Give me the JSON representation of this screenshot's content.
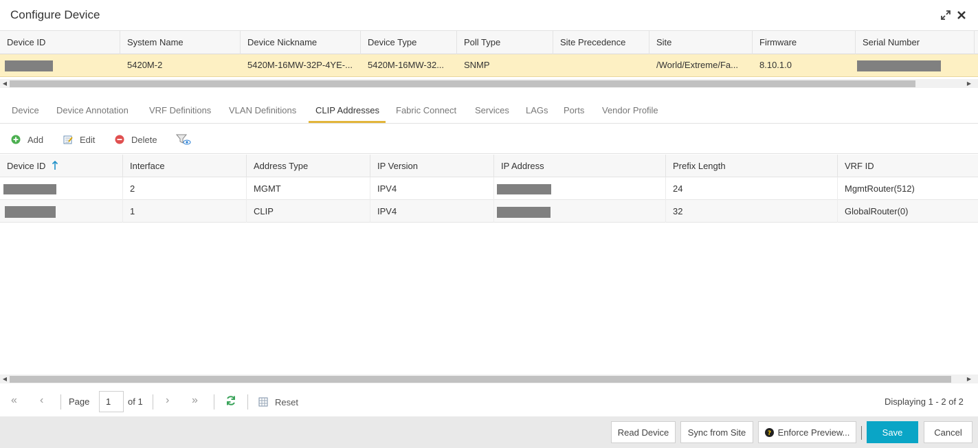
{
  "window": {
    "title": "Configure Device"
  },
  "device_grid": {
    "columns": [
      "Device ID",
      "System Name",
      "Device Nickname",
      "Device Type",
      "Poll Type",
      "Site Precedence",
      "Site",
      "Firmware",
      "Serial Number"
    ],
    "row": {
      "device_id": "",
      "system_name": "5420M-2",
      "device_nickname": "5420M-16MW-32P-4YE-...",
      "device_type": "5420M-16MW-32...",
      "poll_type": "SNMP",
      "site_precedence": "",
      "site": "/World/Extreme/Fa...",
      "firmware": "8.10.1.0",
      "serial_number": ""
    }
  },
  "tabs": [
    {
      "label": "Device",
      "active": false
    },
    {
      "label": "Device Annotation",
      "active": false
    },
    {
      "label": "VRF Definitions",
      "active": false
    },
    {
      "label": "VLAN Definitions",
      "active": false
    },
    {
      "label": "CLIP Addresses",
      "active": true
    },
    {
      "label": "Fabric Connect",
      "active": false
    },
    {
      "label": "Services",
      "active": false
    },
    {
      "label": "LAGs",
      "active": false
    },
    {
      "label": "Ports",
      "active": false
    },
    {
      "label": "Vendor Profile",
      "active": false
    }
  ],
  "toolbar": {
    "add": "Add",
    "edit": "Edit",
    "delete": "Delete",
    "filter_icon": "filter-view-icon"
  },
  "clip_grid": {
    "columns": [
      "Device ID",
      "Interface",
      "Address Type",
      "IP Version",
      "IP Address",
      "Prefix Length",
      "VRF ID"
    ],
    "sort": {
      "column": "Device ID",
      "direction": "ascending"
    },
    "rows": [
      {
        "device_id": "",
        "interface": "2",
        "address_type": "MGMT",
        "ip_version": "IPV4",
        "ip_address": "",
        "prefix_length": "24",
        "vrf_id": "MgmtRouter(512)"
      },
      {
        "device_id": "",
        "interface": "1",
        "address_type": "CLIP",
        "ip_version": "IPV4",
        "ip_address": "",
        "prefix_length": "32",
        "vrf_id": "GlobalRouter(0)"
      }
    ]
  },
  "pager": {
    "page_label": "Page",
    "page_value": "1",
    "of_label": "of 1",
    "reset_label": "Reset",
    "displaying": "Displaying 1 - 2 of 2"
  },
  "footer": {
    "read_device": "Read Device",
    "sync_from_site": "Sync from Site",
    "enforce_preview": "Enforce Preview...",
    "save": "Save",
    "cancel": "Cancel"
  },
  "colors": {
    "accent": "#0aa5c6",
    "selected_row": "#fdf0c3",
    "tab_underline": "#e2b53b",
    "redaction": "#808080"
  }
}
